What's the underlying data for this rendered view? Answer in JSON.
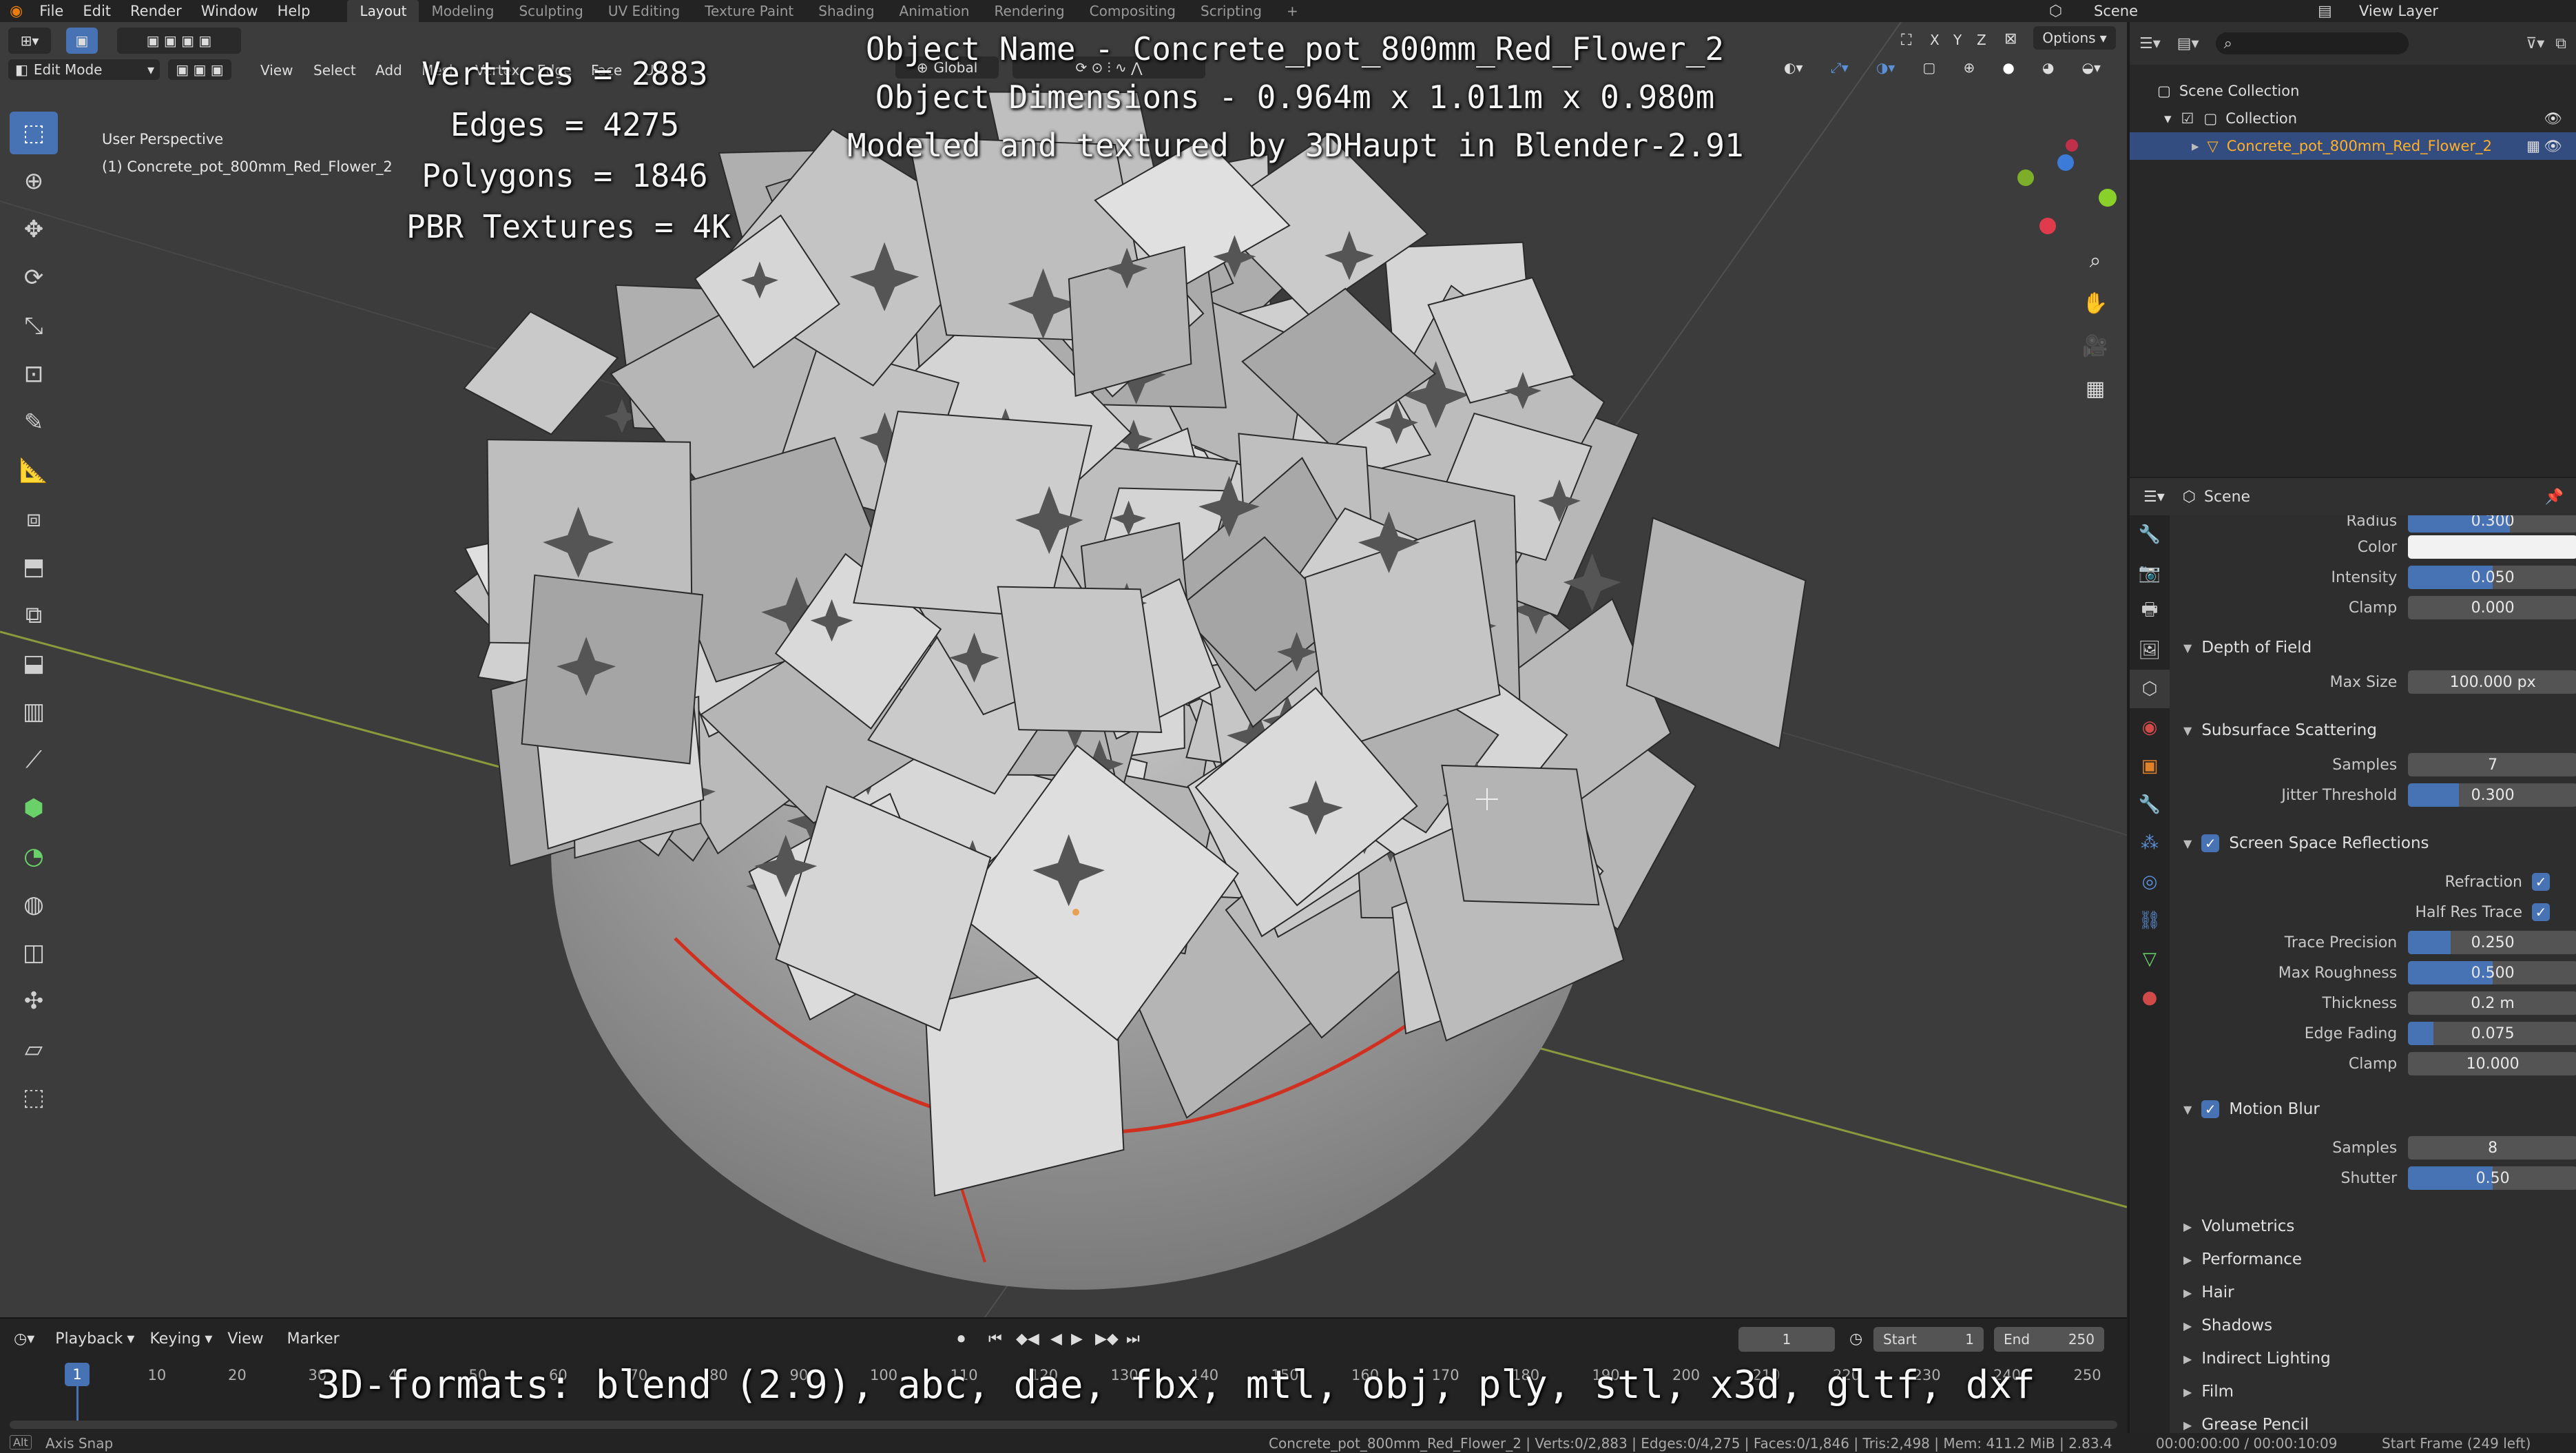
{
  "topbar": {
    "menu": [
      "File",
      "Edit",
      "Render",
      "Window",
      "Help"
    ],
    "workspaces": [
      "Layout",
      "Modeling",
      "Sculpting",
      "UV Editing",
      "Texture Paint",
      "Shading",
      "Animation",
      "Rendering",
      "Compositing",
      "Scripting"
    ],
    "active_workspace": "Layout",
    "add_tab": "+",
    "scene": "Scene",
    "view_layer": "View Layer"
  },
  "viewport": {
    "mode": "Edit Mode",
    "menus": [
      "View",
      "Select",
      "Add",
      "Mesh",
      "Vertex",
      "Edge",
      "Face",
      "UV"
    ],
    "orientation": "Global",
    "axes": [
      "X",
      "Y",
      "Z"
    ],
    "options": "Options",
    "perspective": "User Perspective",
    "object_label": "(1) Concrete_pot_800mm_Red_Flower_2"
  },
  "overlay": {
    "left": [
      "Vertices = 2883",
      "Edges = 4275",
      "Polygons = 1846",
      "PBR Textures = 4K"
    ],
    "top": [
      "Object Name - Concrete_pot_800mm_Red_Flower_2",
      "Object Dimensions -  0.964m x 1.011m x 0.980m",
      "Modeled and textured by 3DHaupt in Blender-2.91"
    ],
    "formats": "3D-formats: blend (2.9), abc, dae, fbx, mtl, obj, ply, stl, x3d, gltf, dxf"
  },
  "outliner": {
    "scene_collection": "Scene Collection",
    "collection": "Collection",
    "object": "Concrete_pot_800mm_Red_Flower_2"
  },
  "properties": {
    "context": "Scene",
    "radius_label": "Radius",
    "radius_value": "0.300",
    "color_label": "Color",
    "intensity": {
      "label": "Intensity",
      "value": "0.050",
      "fraction": 0.5
    },
    "clamp_top": {
      "label": "Clamp",
      "value": "0.000"
    },
    "dof": {
      "title": "Depth of Field",
      "max_size_label": "Max Size",
      "max_size": "100.000 px"
    },
    "sss": {
      "title": "Subsurface Scattering",
      "samples_label": "Samples",
      "samples": "7",
      "jitter_label": "Jitter Threshold",
      "jitter": "0.300",
      "jitter_fraction": 0.3
    },
    "ssr": {
      "title": "Screen Space Reflections",
      "refraction": "Refraction",
      "half_res": "Half Res Trace",
      "trace_precision": {
        "label": "Trace Precision",
        "value": "0.250",
        "fraction": 0.25
      },
      "max_roughness": {
        "label": "Max Roughness",
        "value": "0.500",
        "fraction": 0.5
      },
      "thickness": {
        "label": "Thickness",
        "value": "0.2 m"
      },
      "edge_fading": {
        "label": "Edge Fading",
        "value": "0.075",
        "fraction": 0.15
      },
      "clamp": {
        "label": "Clamp",
        "value": "10.000"
      }
    },
    "motion_blur": {
      "title": "Motion Blur",
      "samples_label": "Samples",
      "samples": "8",
      "shutter_label": "Shutter",
      "shutter": "0.50",
      "shutter_fraction": 0.5
    },
    "collapsed": [
      "Volumetrics",
      "Performance",
      "Hair",
      "Shadows",
      "Indirect Lighting",
      "Film",
      "Grease Pencil"
    ]
  },
  "timeline": {
    "menus": [
      "Playback",
      "Keying",
      "View",
      "Marker"
    ],
    "current_frame": "1",
    "start_label": "Start",
    "start": "1",
    "end_label": "End",
    "end": "250",
    "ticks": [
      "1",
      "10",
      "20",
      "30",
      "40",
      "50",
      "60",
      "70",
      "80",
      "90",
      "100",
      "110",
      "120",
      "130",
      "140",
      "150",
      "160",
      "170",
      "180",
      "190",
      "200",
      "210",
      "220",
      "230",
      "240",
      "250"
    ]
  },
  "statusbar": {
    "left": "Axis Snap",
    "stats": "Concrete_pot_800mm_Red_Flower_2 | Verts:0/2,883 | Edges:0/4,275 | Faces:0/1,846 | Tris:2,498 | Mem: 411.2 MiB | 2.83.4",
    "time": "00:00:00:00 / 00:00:10:09",
    "start_frame": "Start Frame (249 left)"
  },
  "colors": {
    "accent": "#4772b3",
    "selected_text": "#ffaf29",
    "viewport_bg": "#3c3c3c",
    "seam_red": "#d03020",
    "x_axis": "#8a9a3c"
  }
}
